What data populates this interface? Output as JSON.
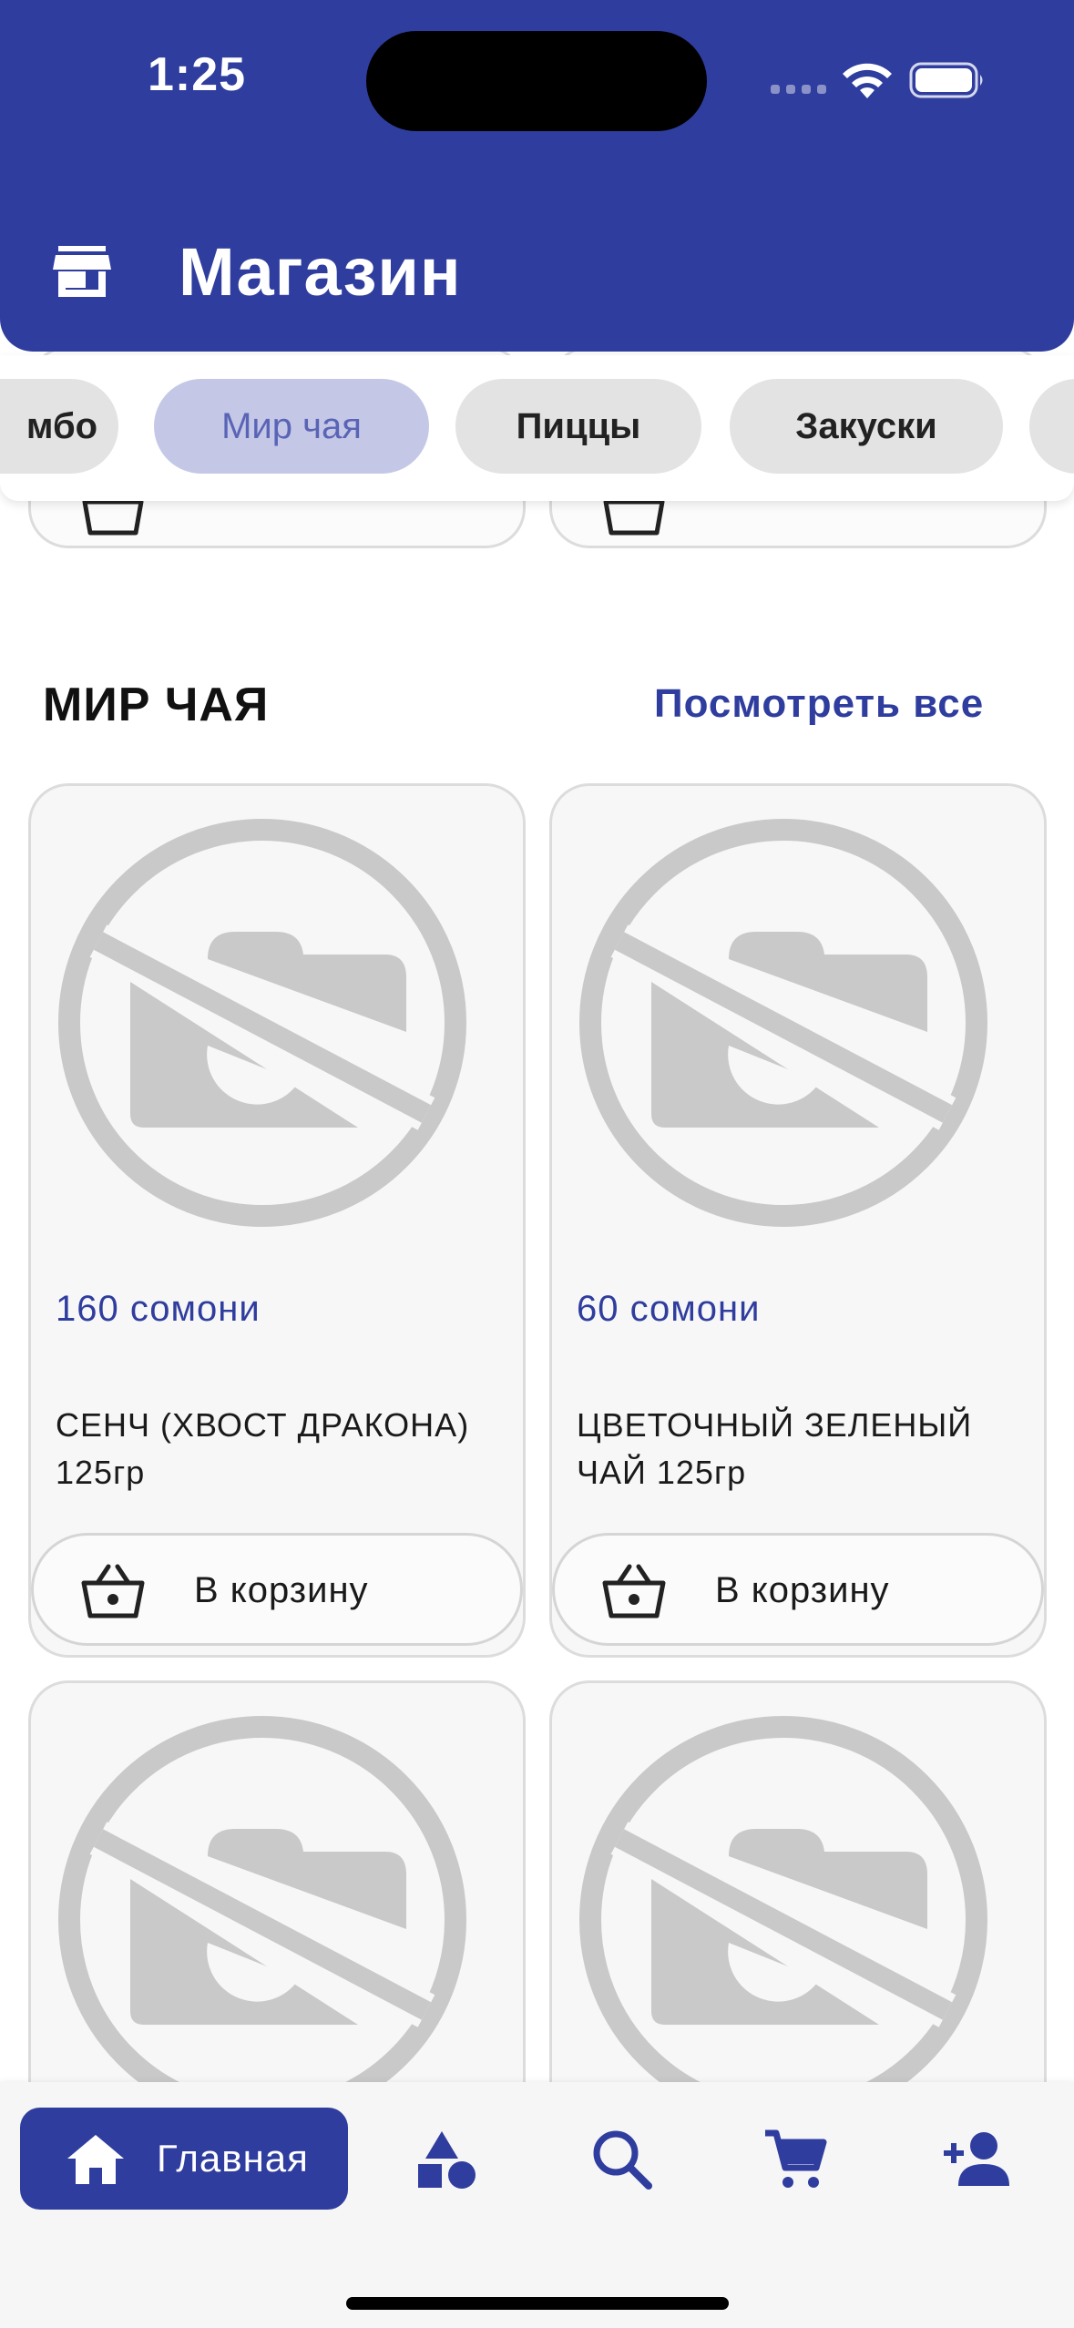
{
  "status_bar": {
    "time": "1:25"
  },
  "header": {
    "title": "Магазин"
  },
  "categories": [
    {
      "label": "мбо",
      "active": false
    },
    {
      "label": "Мир чая",
      "active": true
    },
    {
      "label": "Пиццы",
      "active": false
    },
    {
      "label": "Закуски",
      "active": false
    },
    {
      "label": "",
      "active": false
    }
  ],
  "section": {
    "title": "МИР ЧАЯ",
    "see_all": "Посмотреть все"
  },
  "products": [
    {
      "price": "160 сомони",
      "name": "СЕНЧ (ХВОСТ ДРАКОНА) 125гр",
      "button": "В корзину"
    },
    {
      "price": "60 сомони",
      "name": "ЦВЕТОЧНЫЙ ЗЕЛЕНЫЙ ЧАЙ 125гр",
      "button": "В корзину"
    }
  ],
  "bottom_nav": {
    "items": [
      {
        "label": "Главная",
        "icon": "home-icon",
        "active": true
      },
      {
        "label": "",
        "icon": "categories-icon",
        "active": false
      },
      {
        "label": "",
        "icon": "search-icon",
        "active": false
      },
      {
        "label": "",
        "icon": "cart-icon",
        "active": false
      },
      {
        "label": "",
        "icon": "add-user-icon",
        "active": false
      }
    ]
  },
  "colors": {
    "primary": "#2f3d9e",
    "chip_active_bg": "#c4c8e6",
    "chip_bg": "#e3e3e3",
    "placeholder": "#c9c9c9"
  }
}
